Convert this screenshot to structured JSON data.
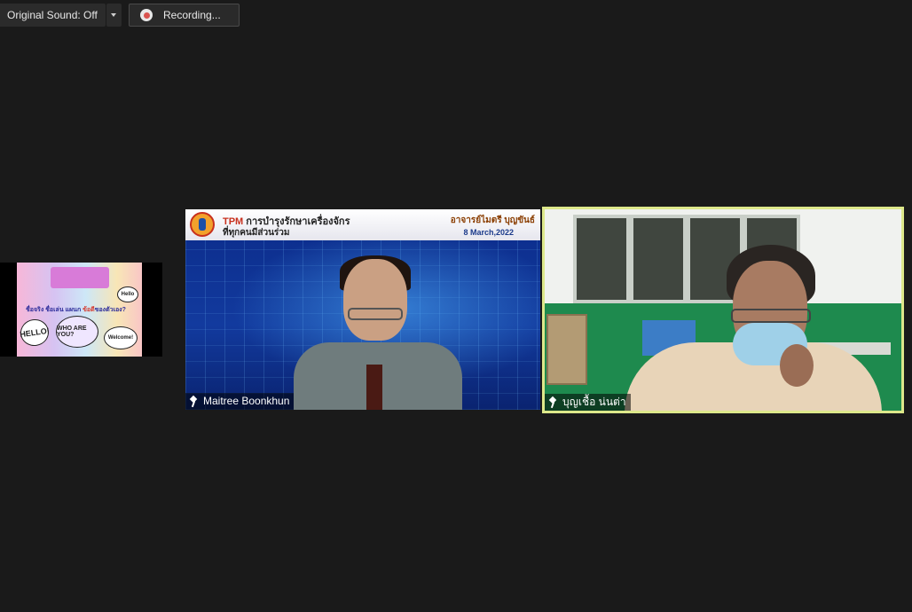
{
  "toolbar": {
    "original_sound_label": "Original Sound: Off",
    "recording_label": "Recording..."
  },
  "thumbnail": {
    "question_prefix": "ชื่อจริง ชื่อเล่น แผนก",
    "question_highlight": "ข้อดี",
    "question_suffix": "ของตัวเอง?",
    "bubble_hello_left": "HELLO!",
    "bubble_who": "WHO ARE YOU?",
    "bubble_welcome": "Welcome!",
    "bubble_hello_right": "Hello"
  },
  "main_tile": {
    "slide_tpm": "TPM",
    "slide_title_line1": "การบำรุงรักษาเครื่องจักร",
    "slide_title_line2": "ที่ทุกคนมีส่วนร่วม",
    "slide_teacher": "อาจารย์ไมตรี บุญขันธ์",
    "slide_date": "8 March,2022",
    "participant_name": "Maitree Boonkhun"
  },
  "active_tile": {
    "participant_name": "บุญเชื้อ น่นต่า",
    "border_color": "#dde88a"
  },
  "icons": [
    "record-dot-icon",
    "dropdown-caret-icon",
    "pin-icon"
  ]
}
